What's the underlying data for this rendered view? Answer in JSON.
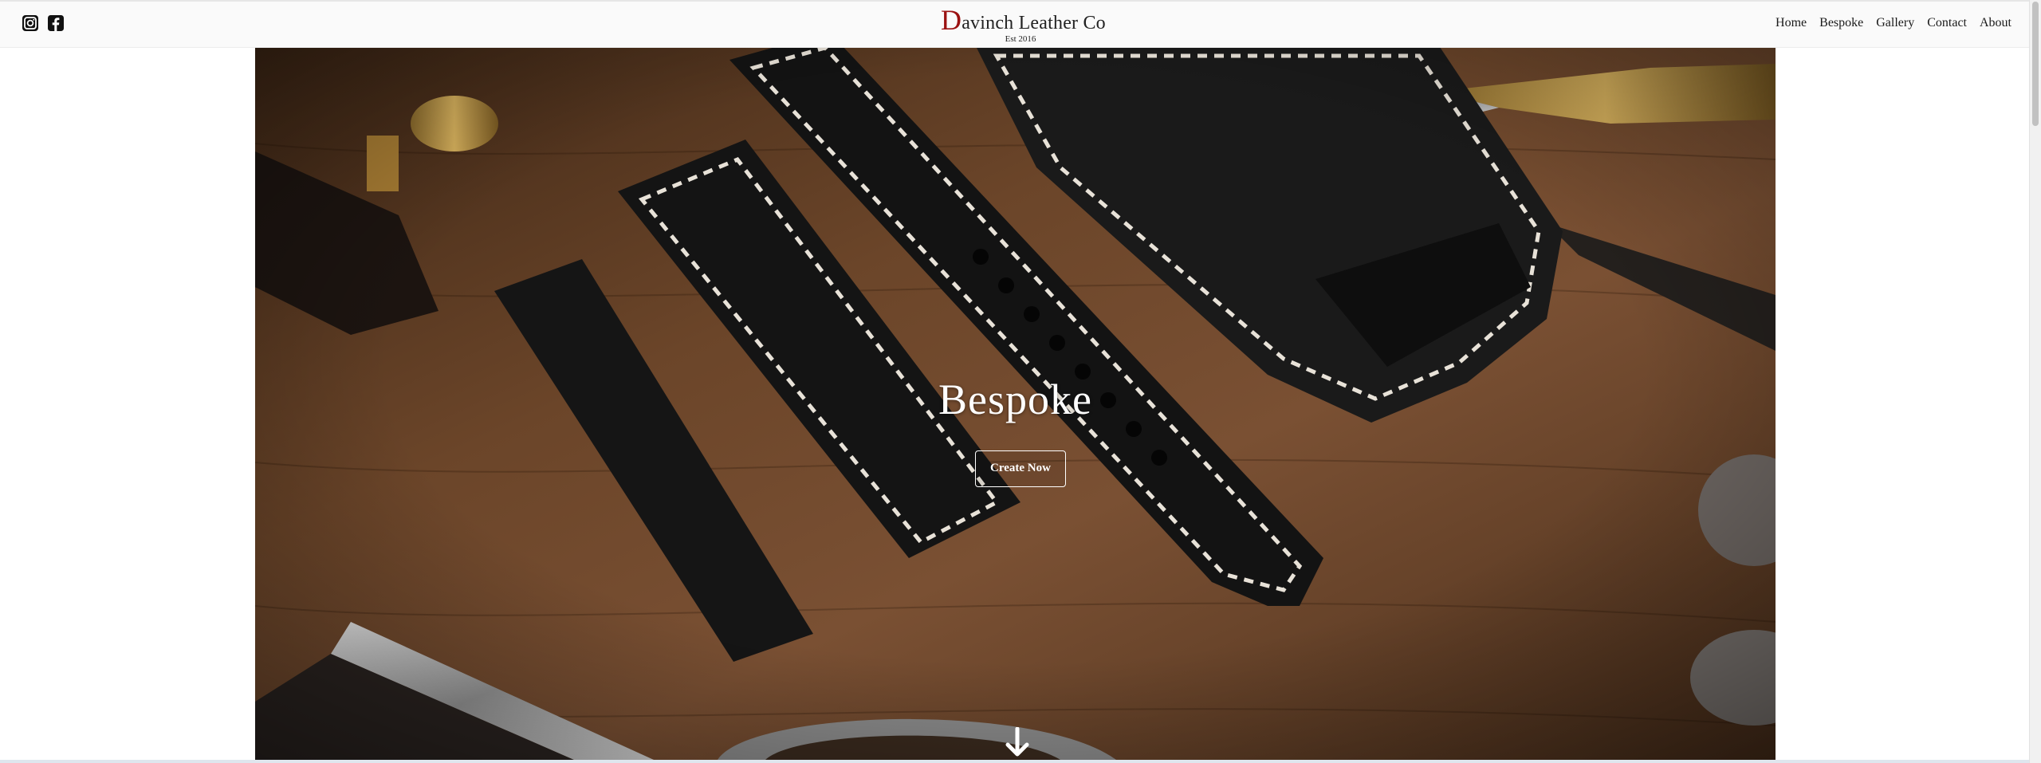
{
  "header": {
    "brand_initial": "D",
    "brand_rest": "avinch Leather Co",
    "brand_subtitle": "Est 2016",
    "social": [
      {
        "name": "instagram-icon"
      },
      {
        "name": "facebook-icon"
      }
    ],
    "nav": [
      "Home",
      "Bespoke",
      "Gallery",
      "Contact",
      "About"
    ]
  },
  "hero": {
    "title": "Bespoke",
    "cta_label": "Create Now"
  },
  "colors": {
    "brand_accent": "#9b1111",
    "header_bg": "#fafafa",
    "hero_text": "#ffffff",
    "wood": "#5a3a22"
  },
  "icons": {
    "scroll_down": "arrow-down-icon"
  }
}
